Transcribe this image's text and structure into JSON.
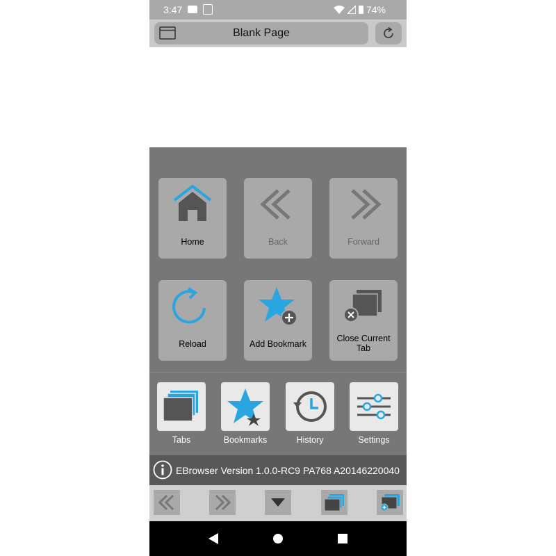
{
  "status_bar": {
    "time": "3:47",
    "battery": "74%"
  },
  "url_bar": {
    "page_title": "Blank Page"
  },
  "menu": {
    "home_label": "Home",
    "back_label": "Back",
    "forward_label": "Forward",
    "reload_label": "Reload",
    "add_bookmark_label": "Add Bookmark",
    "close_tab_label": "Close Current Tab"
  },
  "quick_actions": {
    "tabs_label": "Tabs",
    "bookmarks_label": "Bookmarks",
    "history_label": "History",
    "settings_label": "Settings"
  },
  "version": {
    "text": "EBrowser Version 1.0.0-RC9 PA768 A20146220040"
  },
  "colors": {
    "accent": "#29a6e0",
    "dark_icon": "#555555",
    "tile_bg": "#a9a9a9"
  }
}
